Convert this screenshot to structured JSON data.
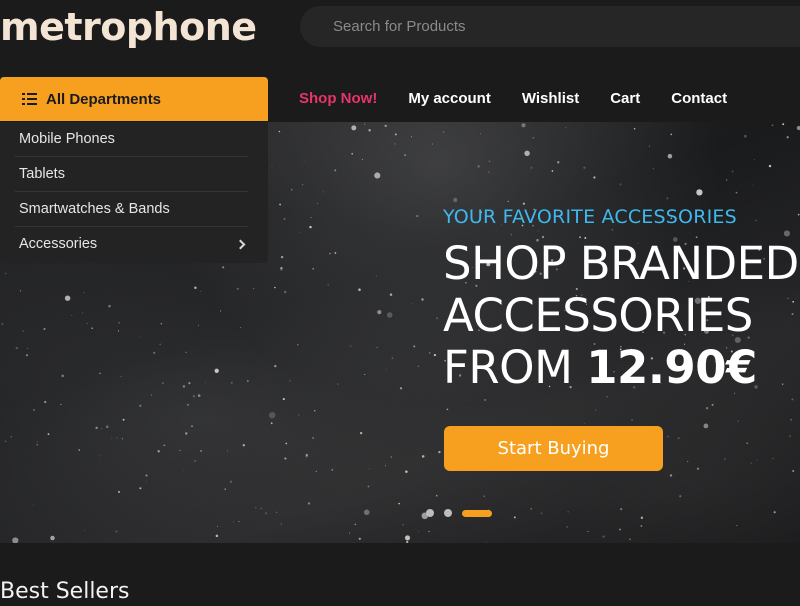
{
  "brand": {
    "logo": "metrophone"
  },
  "search": {
    "placeholder": "Search for Products"
  },
  "departments": {
    "button_label": "All Departments",
    "items": [
      {
        "label": "Mobile Phones",
        "has_submenu": false
      },
      {
        "label": "Tablets",
        "has_submenu": false
      },
      {
        "label": "Smartwatches & Bands",
        "has_submenu": false
      },
      {
        "label": "Accessories",
        "has_submenu": true
      }
    ]
  },
  "nav": {
    "items": [
      {
        "label": "Shop Now!",
        "highlight": true
      },
      {
        "label": "My account"
      },
      {
        "label": "Wishlist"
      },
      {
        "label": "Cart"
      },
      {
        "label": "Contact"
      }
    ]
  },
  "hero": {
    "eyebrow": "YOUR FAVORITE ACCESSORIES",
    "line1": "SHOP BRANDED",
    "line2": "ACCESSORIES",
    "line3_prefix": "FROM",
    "price": "12.90€",
    "cta_label": "Start Buying",
    "slides_total": 3,
    "active_slide": 3
  },
  "sections": {
    "best_sellers_title": "Best Sellers"
  },
  "colors": {
    "accent": "#f7a01f",
    "highlight_link": "#e8336b",
    "eyebrow": "#3fb8ef",
    "background": "#1b1b1b"
  },
  "icons": {
    "departments": "list-icon",
    "submenu": "chevron-right-icon"
  }
}
